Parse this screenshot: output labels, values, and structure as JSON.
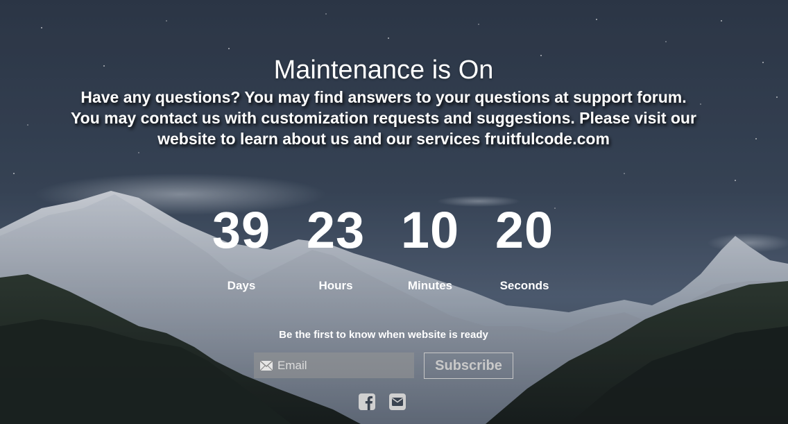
{
  "page": {
    "title": "Maintenance is On",
    "description": "Have any questions? You may find answers to your questions at support forum. You may contact us with customization requests and suggestions. Please visit our website to learn about us and our services fruitfulcode.com"
  },
  "countdown": {
    "units": [
      {
        "value": "39",
        "label": "Days"
      },
      {
        "value": "23",
        "label": "Hours"
      },
      {
        "value": "10",
        "label": "Minutes"
      },
      {
        "value": "20",
        "label": "Seconds"
      }
    ]
  },
  "subscribe": {
    "heading": "Be the first to know when website is ready",
    "email_placeholder": "Email",
    "email_value": "",
    "button_label": "Subscribe"
  },
  "social": {
    "icons": [
      "facebook-icon",
      "email-icon"
    ]
  },
  "colors": {
    "text": "#ffffff",
    "button_text": "#c9c9c9",
    "button_border": "#c8c8c8",
    "input_background": "#969696"
  }
}
